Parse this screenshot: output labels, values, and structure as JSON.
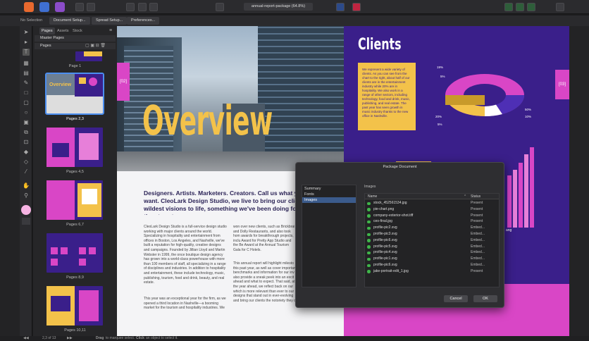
{
  "toolbar": {
    "doc_title": "annual-report-package (64.8%)"
  },
  "context_bar": {
    "selection": "No Selection",
    "buttons": [
      "Document Setup...",
      "Spread Setup...",
      "Preferences..."
    ]
  },
  "pages_panel": {
    "tabs": [
      "Pages",
      "Assets",
      "Stock"
    ],
    "sections": [
      "Master Pages",
      "Pages"
    ],
    "thumbnails": [
      "Page 1",
      "Pages 2,3",
      "Pages 4,5",
      "Pages 6,7",
      "Pages 8,9",
      "Pages 10,11"
    ],
    "selected_label": "Pages 2,3"
  },
  "spread": {
    "overview_title": "Overview",
    "tab_left": "[02]",
    "tab_right": "[03]",
    "clients_title": "Clients",
    "clients_text": "We represent a wide variety of clients. As you can see from the chart to the right, about half of our clients are in the entertainment industry while 20% are in hospitality. We also work in a range of other sectors, including technology, food and drink, music, publishing, and real estate. The past year has seen growth in music industry thanks to the new office in Nashville.",
    "chart_pcts": [
      "19%",
      "5%",
      "50%",
      "10%",
      "20%",
      "5%"
    ],
    "chart_footer": "ang",
    "headline": "Designers. Artists. Marketers. Creators. Call us what you want. CleoLark Design Studio, we live to bring our clients' wildest visions to life, something we've been doing for more than twenty years.",
    "col1": "CleoLark Design Studio is a full-service design studio working with major clients around the world. Specializing in hospitality and entertainment from offices in Boston, Los Angeles, and Nashville, we've built a reputation for high-quality, creative designs and campaigns. Founded by Jillian Lloyd and Martin Webster in 1999, the once boutique design agency has grown into a world-class powerhouse with more than 100 members of staff, all specializing in a range of disciplines and industries. In addition to hospitality and entertainment, these include technology, music, publishing, tourism, food and drink, beauty, and real estate.",
    "col1b": "This year was an exceptional year for the firm, as we opened a third location in Nashville—a booming market for the tourism and hospitality industries. We",
    "col2": "won over new clients, such as Brickbrai and Dolly Restaurants, and also took hom awards for breakthrough projects, inclu Award for Pretty App Studio and the Be Award at the Annual Tourism Gala for C Hotels.",
    "col2b": "This annual report will highlight milesto this past year, as well as cover importan benchmarks and information for our inv also provide a sneak peek into an excit ahead and what to expect. That said, at the year ahead, we reflect back on our which is more relevant than ever to our designs that stand out in ever-evolving and bring our clients the notoriety they d"
  },
  "dialog": {
    "title": "Package Document",
    "nav": [
      "Summary",
      "Fonts",
      "Images"
    ],
    "selected_nav": "Images",
    "section_label": "Images",
    "col_name": "Name",
    "col_status": "Status",
    "rows": [
      {
        "name": "stock_452561534.jpg",
        "status": "Present"
      },
      {
        "name": "pie-chart.png",
        "status": "Present"
      },
      {
        "name": "company-exterior-shot.tiff",
        "status": "Present"
      },
      {
        "name": "ceo-final.jpg",
        "status": "Present"
      },
      {
        "name": "profile-pic2.svg",
        "status": "Embed..."
      },
      {
        "name": "profile-pic3.svg",
        "status": "Embed..."
      },
      {
        "name": "profile-pic6.svg",
        "status": "Embed..."
      },
      {
        "name": "profile-pic5.svg",
        "status": "Embed..."
      },
      {
        "name": "profile-pic4.svg",
        "status": "Embed..."
      },
      {
        "name": "profile-pic1.svg",
        "status": "Embed..."
      },
      {
        "name": "profile-pic6.svg",
        "status": "Embed..."
      },
      {
        "name": "jake-portrait-edit_1.jpg",
        "status": "Present"
      }
    ],
    "cancel": "Cancel",
    "ok": "OK"
  },
  "status_bar": {
    "page": "2,3 of 13",
    "hint_bold1": "Drag",
    "hint1": "to marquee select.",
    "hint_bold2": "Click",
    "hint2": "an object to select it."
  },
  "colors": {
    "accent": "#f3c24a",
    "purple": "#3a1f8a",
    "magenta": "#d946c6",
    "panel": "#262628"
  }
}
